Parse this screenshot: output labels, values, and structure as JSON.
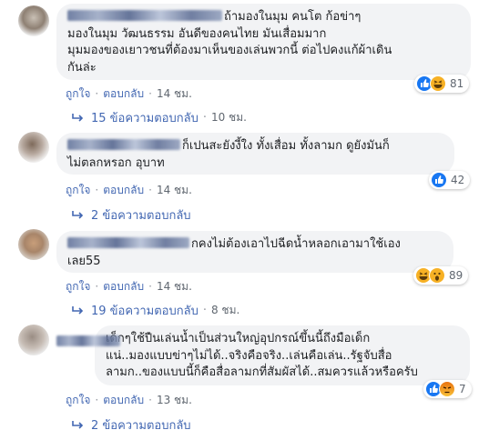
{
  "comments": [
    {
      "text": "ถ้ามองในมุม คนโต ก้อข่าๆ\nมองในมุม วัฒนธรรม อันดีของคนไทย มันเสื่อมมาก\nมุมมองของเยาวชนที่ต้องมาเห็นของเล่นพวกนี้ ต่อไปคงแก้ผ้าเดิน\nกันล่ะ",
      "reactions": [
        "like-icon",
        "haha-icon"
      ],
      "reaction_count": "81",
      "like_label": "ถูกใจ",
      "reply_label": "ตอบกลับ",
      "time": "14 ชม.",
      "replies_label": "15 ข้อความตอบกลับ",
      "replies_time": "10 ชม."
    },
    {
      "text": "ก็เปนสะยังงี้ใง ทั้งเสื่อม ทั้งลามก ดูยังมันก็\nไม่ตลกหรอก อุบาท",
      "reactions": [
        "like-icon"
      ],
      "reaction_count": "42",
      "like_label": "ถูกใจ",
      "reply_label": "ตอบกลับ",
      "time": "14 ชม.",
      "replies_label": "2 ข้อความตอบกลับ",
      "replies_time": ""
    },
    {
      "text": "กคงไม่ต้องเอาไปฉีดน้ำหลอกเอามาใช้เอง\nเลย55",
      "reactions": [
        "haha-icon",
        "wow-icon"
      ],
      "reaction_count": "89",
      "like_label": "ถูกใจ",
      "reply_label": "ตอบกลับ",
      "time": "14 ชม.",
      "replies_label": "19 ข้อความตอบกลับ",
      "replies_time": "8 ชม."
    },
    {
      "text": "เด็กๆใช้ปืนเล่นน้ำเป็นส่วนใหญ่อุปกรณ์ขึ้นนี้ถึงมือเด็ก\nแน่..มองแบบข่าๆไม่ได้..จริงคือจริง..เล่นคือเล่น..รัฐจับสื่อ\nลามก..ของแบบนี้ก็คือสื่อลามกที่สัมผัสได้..สมควรแล้วหรือครับ",
      "reactions": [
        "like-icon",
        "angry-icon"
      ],
      "reaction_count": "7",
      "like_label": "ถูกใจ",
      "reply_label": "ตอบกลับ",
      "time": "13 ชม.",
      "replies_label": "2 ข้อความตอบกลับ",
      "replies_time": ""
    }
  ],
  "colors": {
    "link": "#4267b2",
    "meta": "#606770",
    "bubble": "#f2f3f5"
  }
}
